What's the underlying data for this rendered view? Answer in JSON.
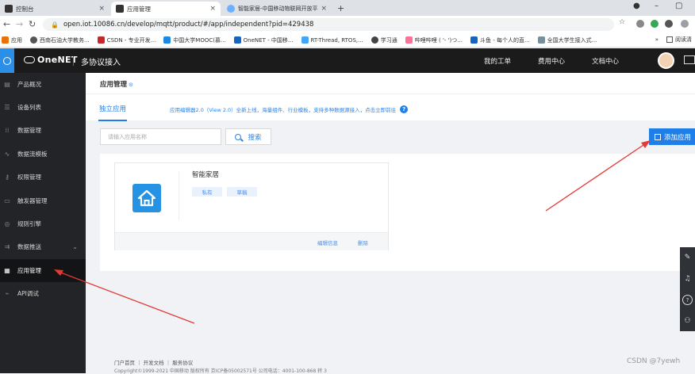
{
  "browser": {
    "tabs": [
      {
        "title": "控制台",
        "favicon_color": "#333333",
        "active": false
      },
      {
        "title": "应用管理",
        "favicon_color": "#333333",
        "active": true
      },
      {
        "title": "智能家居-中国移动物联网开放平",
        "favicon_color": "#6fb1ff",
        "active": false
      }
    ],
    "new_tab_label": "+",
    "url": "open.iot.10086.cn/develop/mqtt/product/#/app/independent?pid=429438",
    "bookmarks": [
      "应用",
      "西南石油大学教务...",
      "CSDN - 专业开发...",
      "中国大学MOOC(慕...",
      "OneNET - 中国移...",
      "RT-Thread, RTOS,...",
      "学习通",
      "哔哩哔哩 ( '- ')つ...",
      "斗鱼 - 每个人的直...",
      "全国大学生接入式..."
    ],
    "bookmark_more": "»",
    "reading_list": "阅读清"
  },
  "header": {
    "brand": "OneNET",
    "subtitle": "多协议接入",
    "links": [
      "我的工单",
      "费用中心",
      "文档中心"
    ]
  },
  "sidebar": {
    "items": [
      {
        "label": "产品概况",
        "icon": "product-icon"
      },
      {
        "label": "设备列表",
        "icon": "list-icon"
      },
      {
        "label": "数据管理",
        "icon": "grid-icon"
      },
      {
        "label": "数据流模板",
        "icon": "stream-icon"
      },
      {
        "label": "权限管理",
        "icon": "key-icon"
      },
      {
        "label": "触发器管理",
        "icon": "trigger-icon"
      },
      {
        "label": "规则引擎",
        "icon": "rule-icon"
      },
      {
        "label": "数据推送",
        "icon": "push-icon",
        "has_chevron": true
      },
      {
        "label": "应用管理",
        "icon": "apps-icon",
        "active": true
      },
      {
        "label": "API调试",
        "icon": "api-icon"
      }
    ]
  },
  "page": {
    "title": "应用管理",
    "tab": "独立应用",
    "notice": "应用编辑器2.0（View 2.0）全新上线，海量组件、行业模板，支持多种数据源接入，点击立即前往",
    "search_placeholder": "请输入应用名称",
    "search_button": "搜索",
    "add_button": "添加应用"
  },
  "apps": [
    {
      "name": "智能家居",
      "tags": [
        "私有",
        "草稿"
      ],
      "actions": [
        "编辑信息",
        "删除"
      ]
    }
  ],
  "footer": {
    "links": "门户首页 ｜ 开发文档 ｜ 服务协议",
    "copyright": "Copyright©1999-2021 中国移动 版权所有 京ICP备05002571号 公司电话：4001-100-868 转 3"
  },
  "watermark": "CSDN @7yewh",
  "colors": {
    "accent": "#1f7ee8",
    "sidebar_bg": "#222427",
    "header_bg": "#1b1b1b",
    "annotation_arrow": "#e53935"
  }
}
